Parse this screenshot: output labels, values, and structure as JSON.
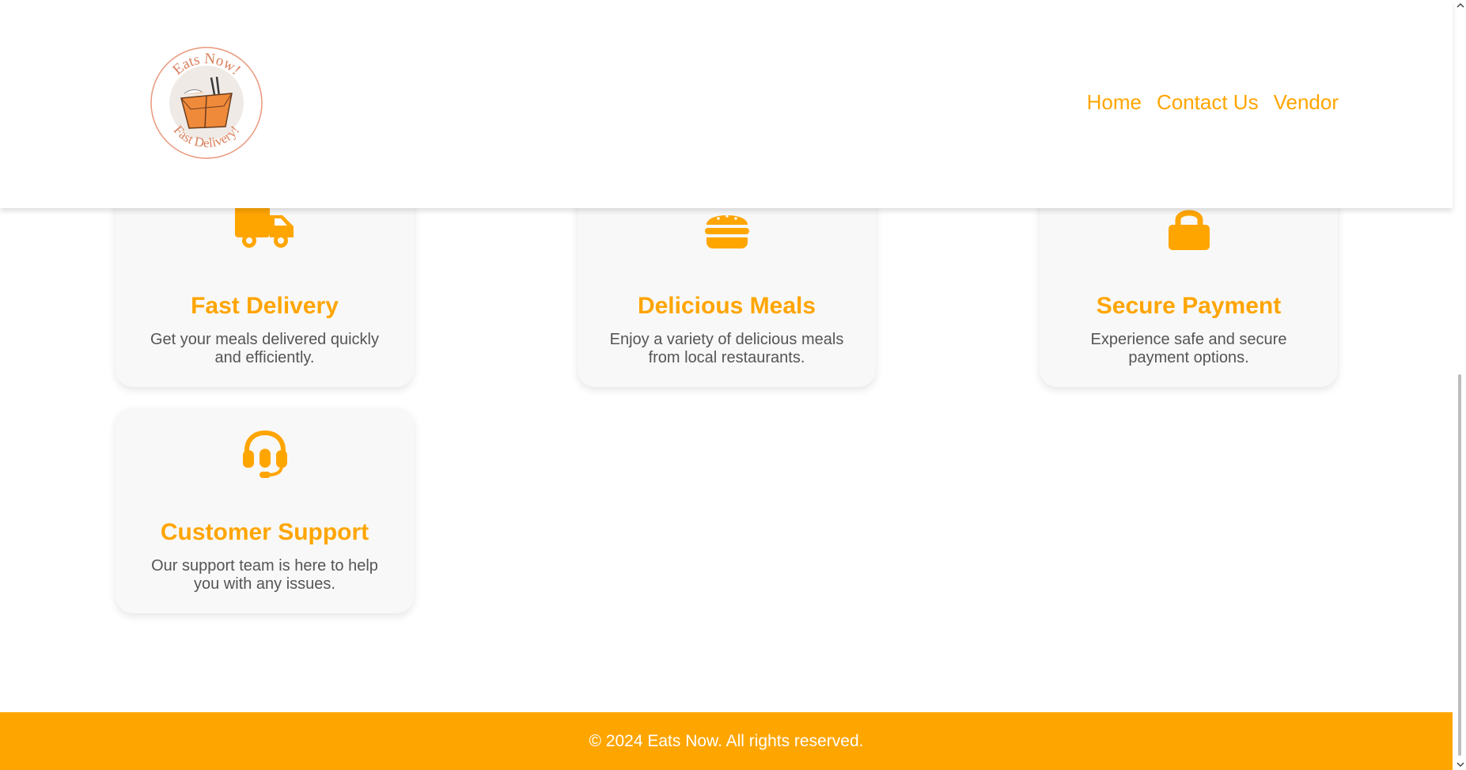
{
  "brand": {
    "logo_text_top": "Eats Now!",
    "logo_text_bottom": "Fast Delivery!",
    "primary_color": "#FFA500"
  },
  "nav": {
    "items": [
      {
        "label": "Home"
      },
      {
        "label": "Contact Us"
      },
      {
        "label": "Vendor"
      }
    ]
  },
  "features": [
    {
      "icon": "truck-icon",
      "title": "Fast Delivery",
      "description": "Get your meals delivered quickly and efficiently."
    },
    {
      "icon": "burger-icon",
      "title": "Delicious Meals",
      "description": "Enjoy a variety of delicious meals from local restaurants."
    },
    {
      "icon": "lock-icon",
      "title": "Secure Payment",
      "description": "Experience safe and secure payment options."
    },
    {
      "icon": "headset-icon",
      "title": "Customer Support",
      "description": "Our support team is here to help you with any issues."
    }
  ],
  "footer": {
    "copyright": "© 2024 Eats Now. All rights reserved."
  }
}
